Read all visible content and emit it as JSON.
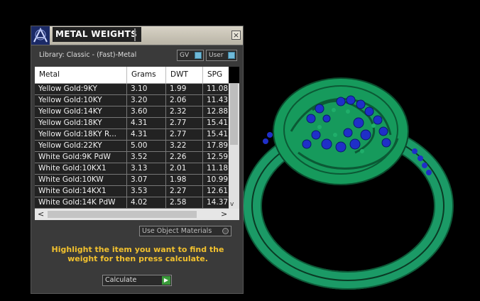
{
  "panel": {
    "title": "METAL WEIGHTS",
    "close_glyph": "×",
    "library_label": "Library: Classic - (Fast)-Metal",
    "gv_label": "GV",
    "user_label": "User"
  },
  "table": {
    "headers": [
      "Metal",
      "Grams",
      "DWT",
      "SPG"
    ],
    "rows": [
      [
        "Yellow Gold:9KY",
        "3.10",
        "1.99",
        "11.08"
      ],
      [
        "Yellow Gold:10KY",
        "3.20",
        "2.06",
        "11.43"
      ],
      [
        "Yellow Gold:14KY",
        "3.60",
        "2.32",
        "12.88"
      ],
      [
        "Yellow Gold:18KY",
        "4.31",
        "2.77",
        "15.41"
      ],
      [
        "Yellow Gold:18KY R...",
        "4.31",
        "2.77",
        "15.41"
      ],
      [
        "Yellow Gold:22KY",
        "5.00",
        "3.22",
        "17.89"
      ],
      [
        "White Gold:9K PdW",
        "3.52",
        "2.26",
        "12.59"
      ],
      [
        "White Gold:10KX1",
        "3.13",
        "2.01",
        "11.18"
      ],
      [
        "White Gold:10KW",
        "3.07",
        "1.98",
        "10.99"
      ],
      [
        "White Gold:14KX1",
        "3.53",
        "2.27",
        "12.61"
      ],
      [
        "White Gold:14K PdW",
        "4.02",
        "2.58",
        "14.37"
      ]
    ],
    "scroll_left": "<",
    "scroll_right": ">",
    "scroll_down": "v"
  },
  "use_object_materials": "Use Object Materials",
  "hint_text": "Highlight the item you want to find the weight for then press calculate.",
  "calculate_label": "Calculate",
  "calculate_icon": "▶",
  "viewport": {
    "model_color": "#1a8c5e",
    "stone_color": "#1f2fc8"
  }
}
